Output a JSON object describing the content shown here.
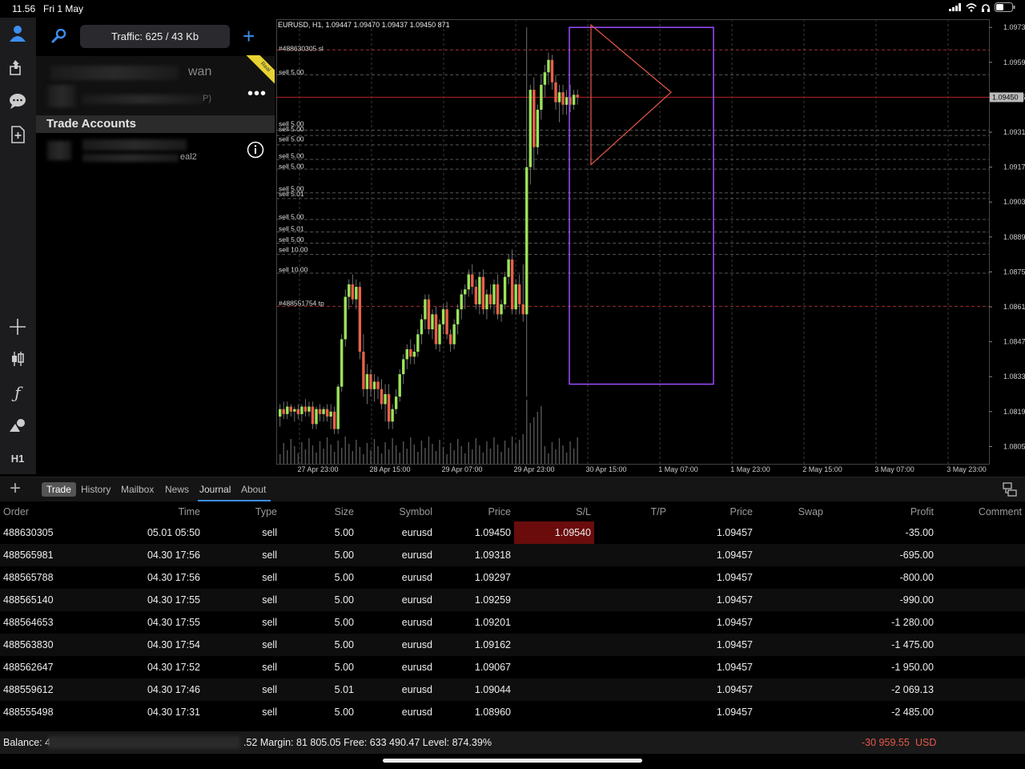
{
  "status_bar": {
    "time": "11.56",
    "date": "Fri 1 May"
  },
  "panel": {
    "traffic": "Traffic: 625 / 43 Kb",
    "account_name_partial": "wan",
    "account_sub_partial": "P)",
    "section_title": "Trade Accounts",
    "account2_partial": "eal2",
    "ribbon": "Real"
  },
  "leftbar": {
    "timeframe": "H1"
  },
  "chart": {
    "header": "EURUSD, H1, 1.09447 1.09470 1.09437 1.09450 871",
    "price_labels": [
      "1.09730",
      "1.09590",
      "1.09450",
      "1.09310",
      "1.09170",
      "1.09030",
      "1.08890",
      "1.08750",
      "1.08610",
      "1.08470",
      "1.08330",
      "1.08190",
      "1.08050"
    ],
    "time_labels": [
      "27 Apr 23:00",
      "28 Apr 15:00",
      "29 Apr 07:00",
      "29 Apr 23:00",
      "30 Apr 15:00",
      "1 May 07:00",
      "1 May 23:00",
      "2 May 15:00",
      "3 May 07:00",
      "3 May 23:00"
    ],
    "order_lines": [
      "#488630305 sl",
      "sell 5.00",
      "sell 5.00",
      "sell 5.00",
      "sell 5.00",
      "sell 5.00",
      "sell 5.00",
      "sell 5.00",
      "sell 5.01",
      "sell 5.00",
      "sell 5.01",
      "sell 5.00",
      "sell 10.00",
      "sell 10.00",
      "#488551754 tp"
    ],
    "current_price": "1.09450",
    "colors": {
      "up": "#9be35a",
      "down": "#e8604a",
      "box": "#9b4dff",
      "triangle": "#e8584a",
      "grid": "#3a3a3a",
      "current": "#a02020"
    }
  },
  "tabs": [
    "Trade",
    "History",
    "Mailbox",
    "News",
    "Journal",
    "About"
  ],
  "table": {
    "headers": [
      "Order",
      "Time",
      "Type",
      "Size",
      "Symbol",
      "Price",
      "S/L",
      "T/P",
      "Price",
      "Swap",
      "Profit",
      "Comment"
    ],
    "rows": [
      {
        "order": "488630305",
        "time": "05.01 05:50",
        "type": "sell",
        "size": "5.00",
        "symbol": "eurusd",
        "price": "1.09450",
        "sl": "1.09540",
        "tp": "",
        "price2": "1.09457",
        "swap": "",
        "profit": "-35.00",
        "comment": ""
      },
      {
        "order": "488565981",
        "time": "04.30 17:56",
        "type": "sell",
        "size": "5.00",
        "symbol": "eurusd",
        "price": "1.09318",
        "sl": "",
        "tp": "",
        "price2": "1.09457",
        "swap": "",
        "profit": "-695.00",
        "comment": ""
      },
      {
        "order": "488565788",
        "time": "04.30 17:56",
        "type": "sell",
        "size": "5.00",
        "symbol": "eurusd",
        "price": "1.09297",
        "sl": "",
        "tp": "",
        "price2": "1.09457",
        "swap": "",
        "profit": "-800.00",
        "comment": ""
      },
      {
        "order": "488565140",
        "time": "04.30 17:55",
        "type": "sell",
        "size": "5.00",
        "symbol": "eurusd",
        "price": "1.09259",
        "sl": "",
        "tp": "",
        "price2": "1.09457",
        "swap": "",
        "profit": "-990.00",
        "comment": ""
      },
      {
        "order": "488564653",
        "time": "04.30 17:55",
        "type": "sell",
        "size": "5.00",
        "symbol": "eurusd",
        "price": "1.09201",
        "sl": "",
        "tp": "",
        "price2": "1.09457",
        "swap": "",
        "profit": "-1 280.00",
        "comment": ""
      },
      {
        "order": "488563830",
        "time": "04.30 17:54",
        "type": "sell",
        "size": "5.00",
        "symbol": "eurusd",
        "price": "1.09162",
        "sl": "",
        "tp": "",
        "price2": "1.09457",
        "swap": "",
        "profit": "-1 475.00",
        "comment": ""
      },
      {
        "order": "488562647",
        "time": "04.30 17:52",
        "type": "sell",
        "size": "5.00",
        "symbol": "eurusd",
        "price": "1.09067",
        "sl": "",
        "tp": "",
        "price2": "1.09457",
        "swap": "",
        "profit": "-1 950.00",
        "comment": ""
      },
      {
        "order": "488559612",
        "time": "04.30 17:46",
        "type": "sell",
        "size": "5.01",
        "symbol": "eurusd",
        "price": "1.09044",
        "sl": "",
        "tp": "",
        "price2": "1.09457",
        "swap": "",
        "profit": "-2 069.13",
        "comment": ""
      },
      {
        "order": "488555498",
        "time": "04.30 17:31",
        "type": "sell",
        "size": "5.00",
        "symbol": "eurusd",
        "price": "1.08960",
        "sl": "",
        "tp": "",
        "price2": "1.09457",
        "swap": "",
        "profit": "-2 485.00",
        "comment": ""
      }
    ]
  },
  "footer": {
    "balance_label": "Balance: 4",
    "summary_partial": ".52 Margin: 81 805.05 Free: 633 490.47 Level: 874.39%",
    "total_profit": "-30 959.55",
    "currency": "USD"
  }
}
